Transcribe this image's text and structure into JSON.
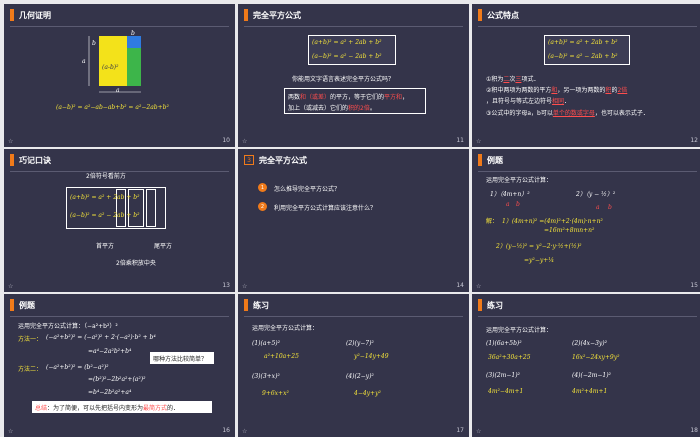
{
  "slides": [
    {
      "title": "几何证明",
      "page": "10",
      "lbl_a": "a",
      "lbl_b": "b",
      "sq_text": "(a-b)²",
      "formula": "(a−b)²  =  a²−ab−ab+b²  =  a²−2ab+b²",
      "colors": {
        "yellow": "#f3e21a",
        "blue": "#2f7be0",
        "green": "#3db54a",
        "red": "#e23b3b"
      }
    },
    {
      "title": "完全平方公式",
      "page": "11",
      "f1": "(a+b)²   =   a² + 2ab + b²",
      "f2": "(a−b)²   =   a² − 2ab + b²",
      "question": "你能用文字语言表述完全平方公式吗？",
      "desc1_a": "两数",
      "desc1_b": "和（或差）",
      "desc1_c": "的平方，等于它们的",
      "desc1_d": "平方和",
      "desc1_e": "，",
      "desc2_a": "加上（或减去）它们的",
      "desc2_b": "积的2倍",
      "desc2_c": "。"
    },
    {
      "title": "公式特点",
      "page": "12",
      "f1": "(a+b)²   =   a² + 2ab + b²",
      "f2": "(a−b)²   =   a² − 2ab + b²",
      "p1_a": "①积为",
      "p1_b": "二",
      "p1_c": "次",
      "p1_d": "三",
      "p1_e": "项式．",
      "p2_a": "②积中两项为两数的平方",
      "p2_b": "和",
      "p2_c": "，另一项为两数的",
      "p2_d": "积",
      "p2_e": "的",
      "p2_f": "2倍",
      "p3_a": "，且符号与等式左边符号",
      "p3_b": "相同",
      "p3_c": "．",
      "p4_a": "③公式中的字母a，b可以",
      "p4_b": "单个的数或字母",
      "p4_c": "，也可以表示式子．"
    },
    {
      "title": "巧记口诀",
      "page": "13",
      "top_label": "2倍符号看前方",
      "f1": "(a+b)²   =   a²  + 2ab + b²",
      "f2": "(a−b)²   =   a²  − 2ab + b²",
      "lbl_first": "首平方",
      "lbl_last": "尾平方",
      "lbl_mid": "2倍乘积放中央"
    },
    {
      "title": "完全平方公式",
      "title_num": "3",
      "page": "14",
      "q1_num": "1",
      "q1": "怎么推导完全平方公式？",
      "q2_num": "2",
      "q2": "利用完全平方公式计算应该注意什么？"
    },
    {
      "title": "例题",
      "page": "15",
      "intro": "运用完全平方公式计算：",
      "e1": "1）（4m+n）²",
      "e2": "2）（y − ½）²",
      "e1_a": "a",
      "e1_b": "b",
      "e2_a": "a",
      "e2_b": "b",
      "sol_label": "解：",
      "s1": "1）(4m+n)² =(4m)²+2·(4m)·n+n²",
      "s2": "=16m²+8mn+n²",
      "s3": "2）(y−½)² = y²−2·y·½+(½)²",
      "s4": "=y²−y+¼"
    },
    {
      "title": "例题",
      "page": "16",
      "intro": "运用完全平方公式计算：（−a²+b²）²",
      "m1_label": "方法一：",
      "m1_l1": "(−a²+b²)² = (−a²)² + 2·(−a²)·b² + b⁴",
      "m1_l2": "=a⁴−2a²b²+b⁴",
      "bubble": "哪种方法比较简单？",
      "m2_label": "方法二：",
      "m2_l1": "(−a²+b²)² = (b²−a²)²",
      "m2_l2": "=(b²)²−2b²a²+(a²)²",
      "m2_l3": "=b⁴−2b²a²+a⁴",
      "sum_a": "总结",
      "sum_b": "：为了简便，可以先把括号内变形为",
      "sum_c": "最简方式",
      "sum_d": "的．"
    },
    {
      "title": "练习",
      "page": "17",
      "intro": "运用完全平方公式计算：",
      "p1": "(1)(a+5)²",
      "a1": "a²+10a+25",
      "p2": "(2)(y−7)²",
      "a2": "y²−14y+49",
      "p3": "(3)(3+x)²",
      "a3": "9+6x+x²",
      "p4": "(4)(2−y)²",
      "a4": "4−4y+y²"
    },
    {
      "title": "练习",
      "page": "18",
      "intro": "运用完全平方公式计算：",
      "p1": "(1)(6a+5b)²",
      "a1": "36a²+30a+25",
      "p2": "(2)(4x−3y)²",
      "a2": "16x²−24xy+9y²",
      "p3": "(3)(2m−1)²",
      "a3": "4m²−4m+1",
      "p4": "(4)(−2m−1)²",
      "a4": "4m²+4m+1"
    }
  ],
  "star_glyph": "☆"
}
